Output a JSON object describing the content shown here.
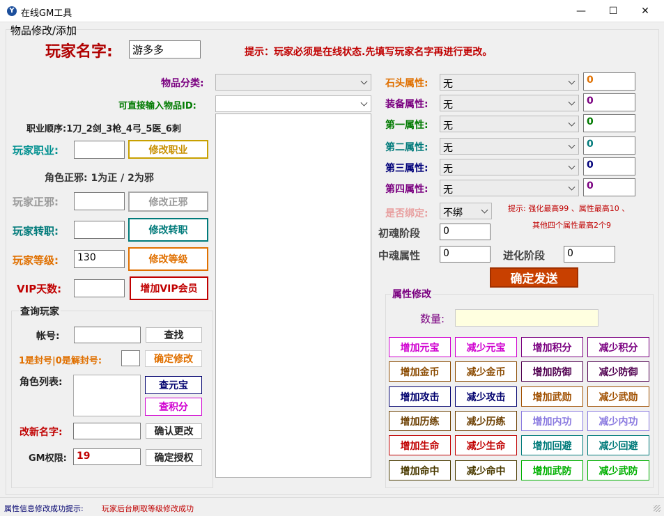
{
  "window": {
    "title": "在线GM工具",
    "min": "—",
    "max": "☐",
    "close": "✕"
  },
  "menu": {
    "label": "物品修改/添加"
  },
  "player": {
    "name_label": "玩家名字:",
    "name_value": "游多多",
    "tip": "提示：玩家必须是在线状态.先填写玩家名字再进行更改。"
  },
  "left": {
    "job_order": "职业顺序:1刀_2剑_3枪_4弓_5医_6刺",
    "job_label": "玩家职业:",
    "job_value": "",
    "job_btn": "修改职业",
    "align_note": "角色正邪: 1为正 / 2为邪",
    "align_label": "玩家正邪:",
    "align_value": "",
    "align_btn": "修改正邪",
    "transfer_label": "玩家转职:",
    "transfer_value": "",
    "transfer_btn": "修改转职",
    "level_label": "玩家等级:",
    "level_value": "130",
    "level_btn": "修改等级",
    "vip_label": "VIP天数:",
    "vip_value": "",
    "vip_btn": "增加VIP会员",
    "query_group": "查询玩家",
    "account_label": "帐号:",
    "account_value": "",
    "find_btn": "查找",
    "ban_label": "1是封号|0是解封号:",
    "ban_value": "",
    "ban_btn": "确定修改",
    "role_list_label": "角色列表:",
    "check_yuanbao_btn": "查元宝",
    "check_points_btn": "查积分",
    "rename_label": "改新名字:",
    "rename_value": "",
    "rename_btn": "确认更改",
    "gm_label": "GM权限:",
    "gm_value": "19",
    "gm_btn": "确定授权"
  },
  "middle": {
    "category_label": "物品分类:",
    "category_value": "",
    "itemid_label": "可直接输入物品ID:",
    "itemid_value": ""
  },
  "right": {
    "attrs": [
      {
        "label": "石头属性:",
        "value": "无",
        "num": "0",
        "color": "#e07000"
      },
      {
        "label": "装备属性:",
        "value": "无",
        "num": "0",
        "color": "#7a0080"
      },
      {
        "label": "第一属性:",
        "value": "无",
        "num": "0",
        "color": "#007a00"
      },
      {
        "label": "第二属性:",
        "value": "无",
        "num": "0",
        "color": "#007a7a"
      },
      {
        "label": "第三属性:",
        "value": "无",
        "num": "0",
        "color": "#00007a"
      },
      {
        "label": "第四属性:",
        "value": "无",
        "num": "0",
        "color": "#7a0080"
      }
    ],
    "bind_label": "是否绑定:",
    "bind_value": "不绑",
    "tip1": "提示: 强化最高99 、属性最高10 、",
    "tip2": "其他四个属性最高2个9",
    "soul_label": "初魂阶段",
    "soul_value": "0",
    "mid_soul_label": "中魂属性",
    "mid_soul_value": "0",
    "evolve_label": "进化阶段",
    "evolve_value": "0",
    "send_btn": "确定发送"
  },
  "attr_modify": {
    "group": "属性修改",
    "qty_label": "数量:",
    "qty_value": "",
    "buttons": [
      {
        "label": "增加元宝",
        "color": "#d000d0"
      },
      {
        "label": "减少元宝",
        "color": "#d000d0"
      },
      {
        "label": "增加积分",
        "color": "#7a0080"
      },
      {
        "label": "减少积分",
        "color": "#7a0080"
      },
      {
        "label": "增加金币",
        "color": "#8a4a00"
      },
      {
        "label": "减少金币",
        "color": "#8a4a00"
      },
      {
        "label": "增加防御",
        "color": "#500050"
      },
      {
        "label": "减少防御",
        "color": "#500050"
      },
      {
        "label": "增加攻击",
        "color": "#00006e"
      },
      {
        "label": "减少攻击",
        "color": "#00006e"
      },
      {
        "label": "增加武勋",
        "color": "#a05000"
      },
      {
        "label": "减少武勋",
        "color": "#a05000"
      },
      {
        "label": "增加历练",
        "color": "#6b3e00"
      },
      {
        "label": "减少历练",
        "color": "#6b3e00"
      },
      {
        "label": "增加内功",
        "color": "#8a7ae0"
      },
      {
        "label": "减少内功",
        "color": "#8a7ae0"
      },
      {
        "label": "增加生命",
        "color": "#c00000"
      },
      {
        "label": "减少生命",
        "color": "#c00000"
      },
      {
        "label": "增加回避",
        "color": "#007a7a"
      },
      {
        "label": "减少回避",
        "color": "#007a7a"
      },
      {
        "label": "增加命中",
        "color": "#4a3a00"
      },
      {
        "label": "减少命中",
        "color": "#4a3a00"
      },
      {
        "label": "增加武防",
        "color": "#00b000"
      },
      {
        "label": "减少武防",
        "color": "#00b000"
      }
    ]
  },
  "status": {
    "label": "属性信息修改成功提示:",
    "message": "玩家后台刷取等级修改成功"
  }
}
